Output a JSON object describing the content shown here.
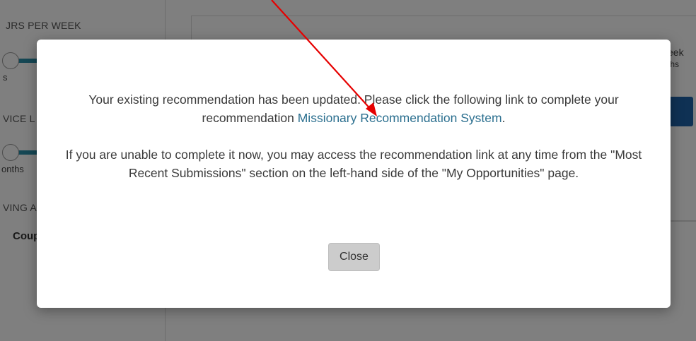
{
  "background": {
    "sidebar": {
      "hours_heading": "JRS PER WEEK",
      "hours_caption": "s",
      "service_heading": "VICE L",
      "service_caption": "onths",
      "living_heading": "VING A",
      "living_option": "Coup"
    },
    "content": {
      "right_text_1": "eek",
      "right_text_2": "ths"
    }
  },
  "modal": {
    "message_before_link": "Your existing recommendation has been updated. Please click the following link to complete your recommendation ",
    "link_label": "Missionary Recommendation System",
    "message_after_link": ".",
    "message_2": "If you are unable to complete it now, you may access the recommendation link at any time from the \"Most Recent Submissions\" section on the left-hand side of the \"My Opportunities\" page.",
    "close_label": "Close"
  },
  "annotation": {
    "arrow_color": "#e60000"
  }
}
